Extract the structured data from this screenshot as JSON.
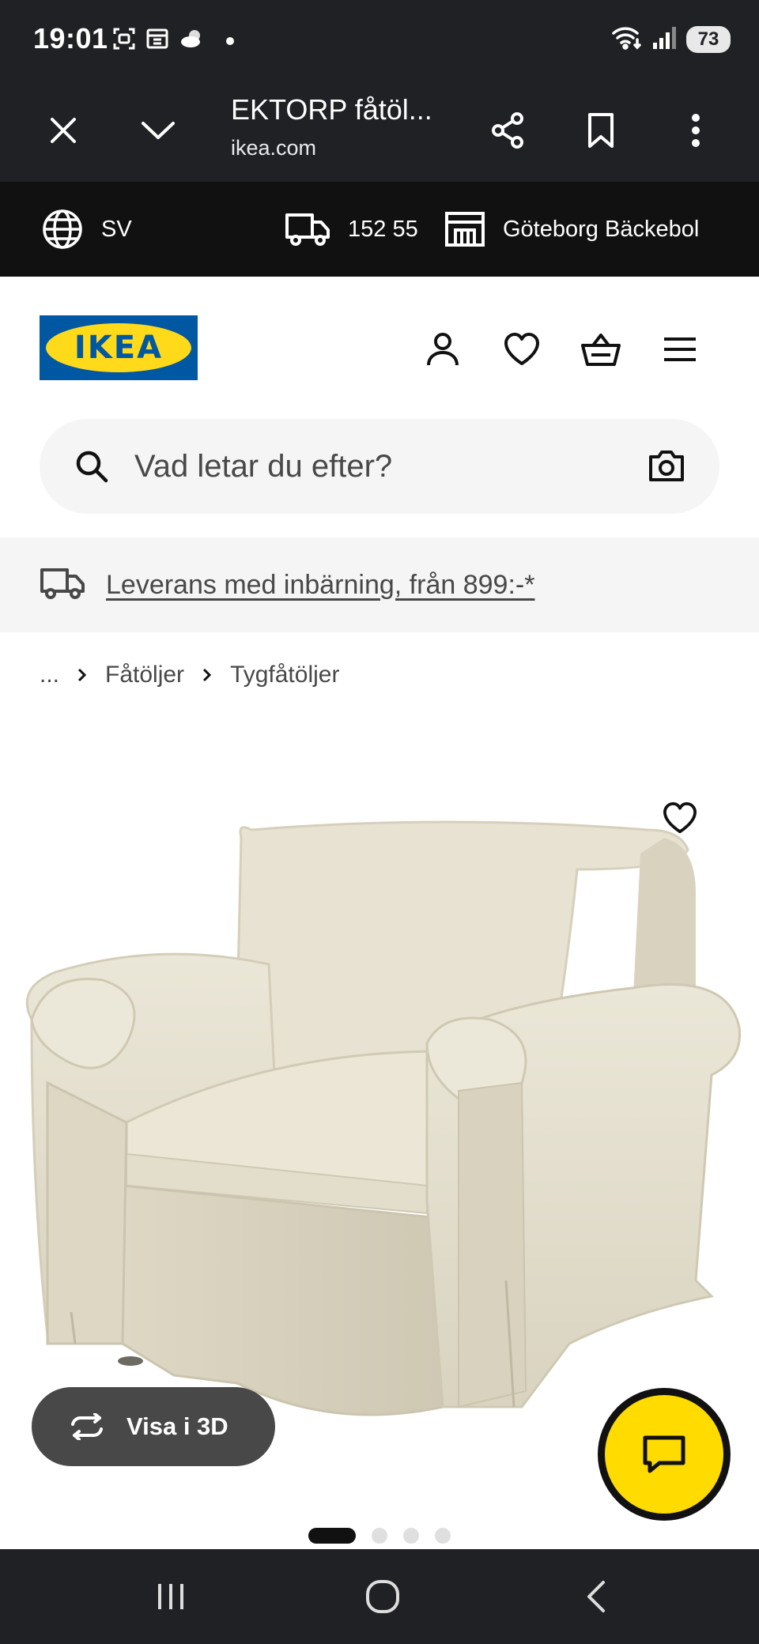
{
  "status_bar": {
    "time": "19:01",
    "battery": "73",
    "icons": [
      "screenshot-icon",
      "calendar-icon",
      "weather-icon",
      "notification-dot",
      "wifi-icon",
      "signal-icon",
      "battery-icon"
    ]
  },
  "browser": {
    "title": "EKTORP fåtöl...",
    "url": "ikea.com",
    "icons": [
      "close-icon",
      "chevron-down-icon",
      "share-icon",
      "bookmark-icon",
      "more-vert-icon"
    ]
  },
  "store_bar": {
    "language": "SV",
    "postal_code": "152 55",
    "store": "Göteborg Bäckebol"
  },
  "header": {
    "logo_text": "IKEA",
    "icons": [
      "account-icon",
      "heart-icon",
      "basket-icon",
      "hamburger-menu-icon"
    ]
  },
  "search": {
    "placeholder": "Vad letar du efter?"
  },
  "promo": {
    "text": "Leverans med inbärning, från 899:-*"
  },
  "breadcrumb": {
    "items": [
      "...",
      "Fåtöljer",
      "Tygfåtöljer"
    ]
  },
  "product": {
    "view_3d_label": "Visa i 3D",
    "image_count": 4,
    "active_image": 1
  },
  "colors": {
    "ikea_blue": "#0058a3",
    "ikea_yellow": "#ffda1a",
    "chat_yellow": "#ffdb00",
    "chrome_dark": "#202124",
    "store_bar": "#111111",
    "promo_bg": "#f5f5f5"
  }
}
